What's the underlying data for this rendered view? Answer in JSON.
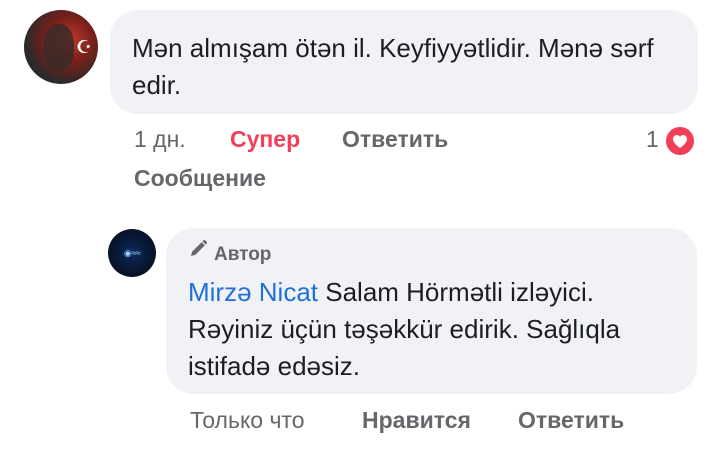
{
  "comment": {
    "text": "Mən almışam ötən il. Keyfiyyətlidir. Mənə sərf edir.",
    "time": "1 дн.",
    "reaction_label": "Супер",
    "reply_label": "Ответить",
    "message_label": "Сообщение",
    "reaction_count": "1",
    "reaction_icon": "heart-icon",
    "reaction_color": "#f33e58"
  },
  "reply": {
    "badge_label": "Автор",
    "badge_icon": "pencil-icon",
    "author_name": "Mirzə Nicat",
    "text": " Salam Hörmətli izləyici. Rəyiniz üçün təşəkkür edirik. Sağlıqla istifadə edəsiz.",
    "author_color": "#216fdb",
    "time": "Только что",
    "like_label": "Нравится",
    "reply_label": "Ответить"
  }
}
